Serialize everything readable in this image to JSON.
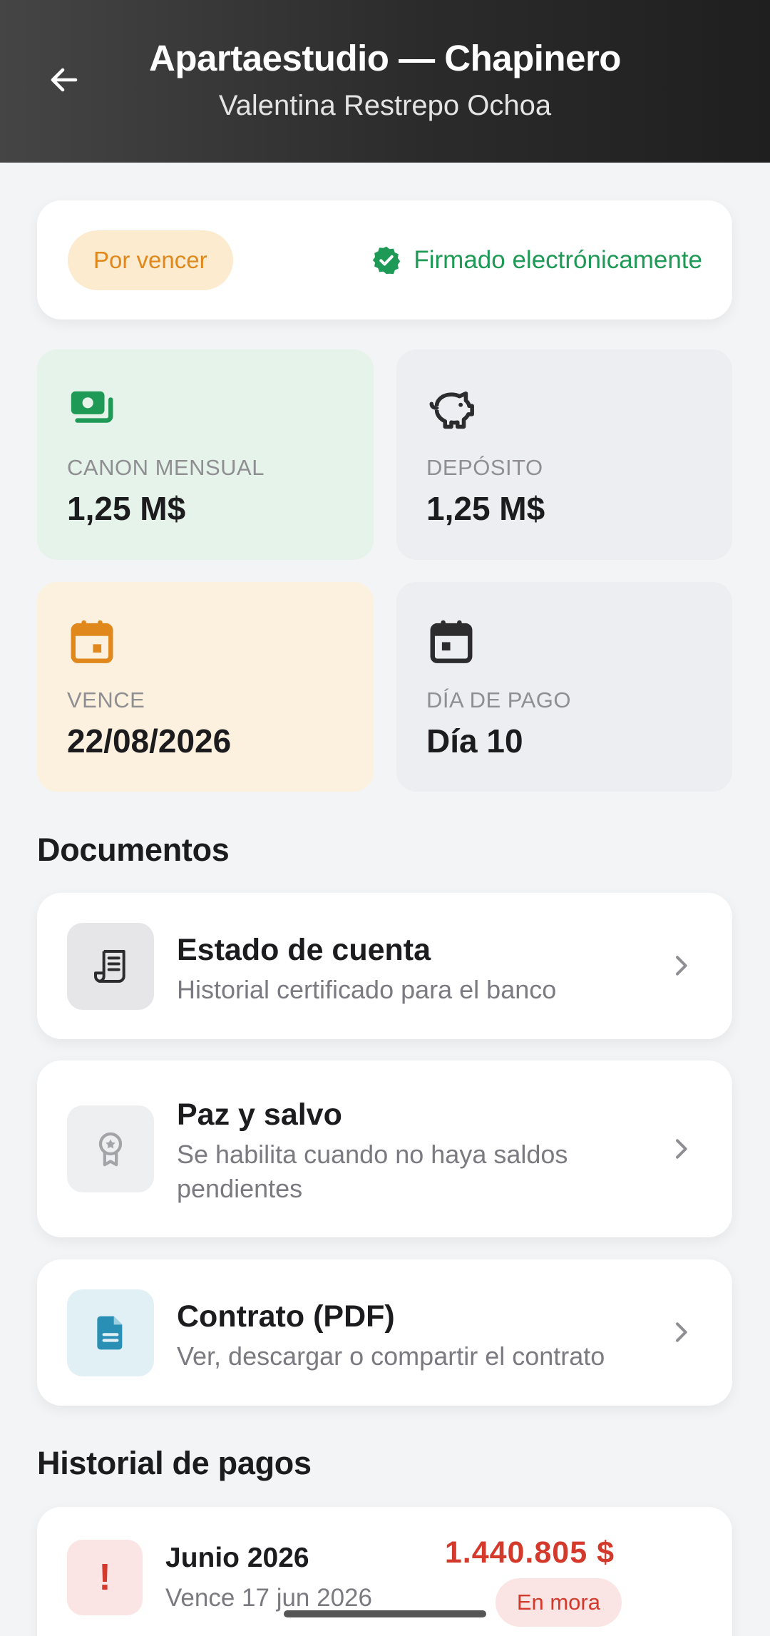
{
  "header": {
    "title": "Apartaestudio — Chapinero",
    "subtitle": "Valentina Restrepo Ochoa",
    "back_icon": "arrow-left-icon"
  },
  "status": {
    "badge": "Por vencer",
    "signed_label": "Firmado electrónicamente",
    "signed_icon": "verified-badge-icon",
    "colors": {
      "warning": "#e0881c",
      "success": "#1f9a56"
    }
  },
  "tiles": {
    "rent": {
      "label": "CANON MENSUAL",
      "value": "1,25 M$",
      "icon": "money-icon"
    },
    "deposit": {
      "label": "DEPÓSITO",
      "value": "1,25 M$",
      "icon": "piggy-bank-icon"
    },
    "expires": {
      "label": "VENCE",
      "value": "22/08/2026",
      "icon": "calendar-icon"
    },
    "payday": {
      "label": "DÍA DE PAGO",
      "value": "Día 10",
      "icon": "calendar-icon"
    }
  },
  "documents": {
    "title": "Documentos",
    "items": [
      {
        "title": "Estado de cuenta",
        "subtitle": "Historial certificado para el banco",
        "icon": "receipt-icon"
      },
      {
        "title": "Paz y salvo",
        "subtitle": "Se habilita cuando no haya saldos pendientes",
        "icon": "award-ribbon-icon"
      },
      {
        "title": "Contrato (PDF)",
        "subtitle": "Ver, descargar o compartir el contrato",
        "icon": "document-icon"
      }
    ]
  },
  "payments": {
    "title": "Historial de pagos",
    "items": [
      {
        "month": "Junio 2026",
        "due": "Vence 17 jun 2026",
        "amount": "1.440.805 $",
        "status": "En mora",
        "icon": "exclamation-icon",
        "alert_mark": "!"
      }
    ]
  }
}
